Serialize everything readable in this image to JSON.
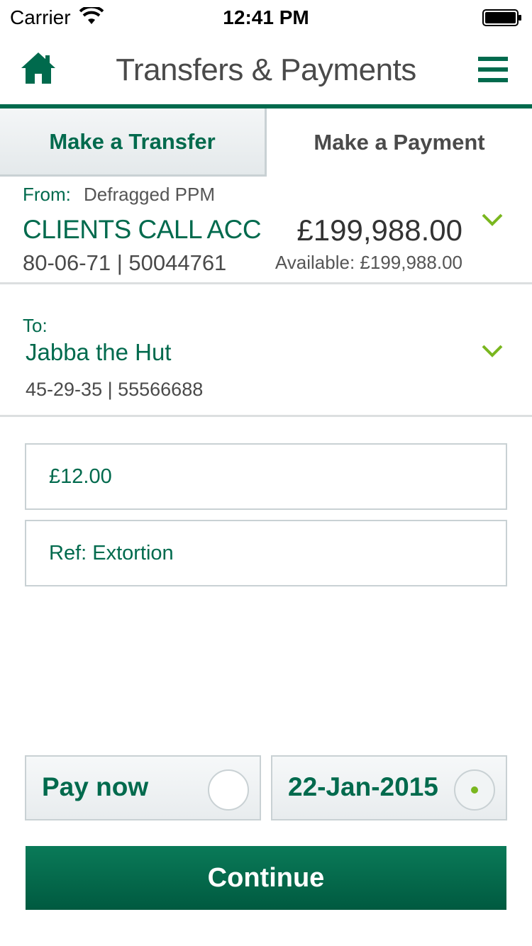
{
  "status_bar": {
    "carrier": "Carrier",
    "time": "12:41 PM"
  },
  "header": {
    "title": "Transfers & Payments",
    "home_icon": "home-icon",
    "menu_icon": "hamburger-menu-icon"
  },
  "tabs": [
    {
      "label": "Make a Transfer",
      "selected": false
    },
    {
      "label": "Make a Payment",
      "selected": true
    }
  ],
  "from": {
    "prefix": "From:",
    "nickname": "Defragged PPM",
    "account_name": "CLIENTS CALL ACC",
    "sort_and_account": "80-06-71 | 50044761",
    "balance": "£199,988.00",
    "available": "Available:  £199,988.00"
  },
  "to": {
    "prefix": "To:",
    "payee_name": "Jabba the Hut",
    "sort_and_account": "45-29-35 | 55566688"
  },
  "amount": {
    "value": "£12.00"
  },
  "reference": {
    "value": "Ref: Extortion"
  },
  "payment_date": {
    "pay_now_label": "Pay now",
    "pay_now_selected": false,
    "date_label": "22-Jan-2015",
    "date_selected": true
  },
  "continue_label": "Continue",
  "colors": {
    "brand_green": "#006a4d",
    "accent_lime": "#7ab71f",
    "text_grey": "#4a4a4a"
  }
}
